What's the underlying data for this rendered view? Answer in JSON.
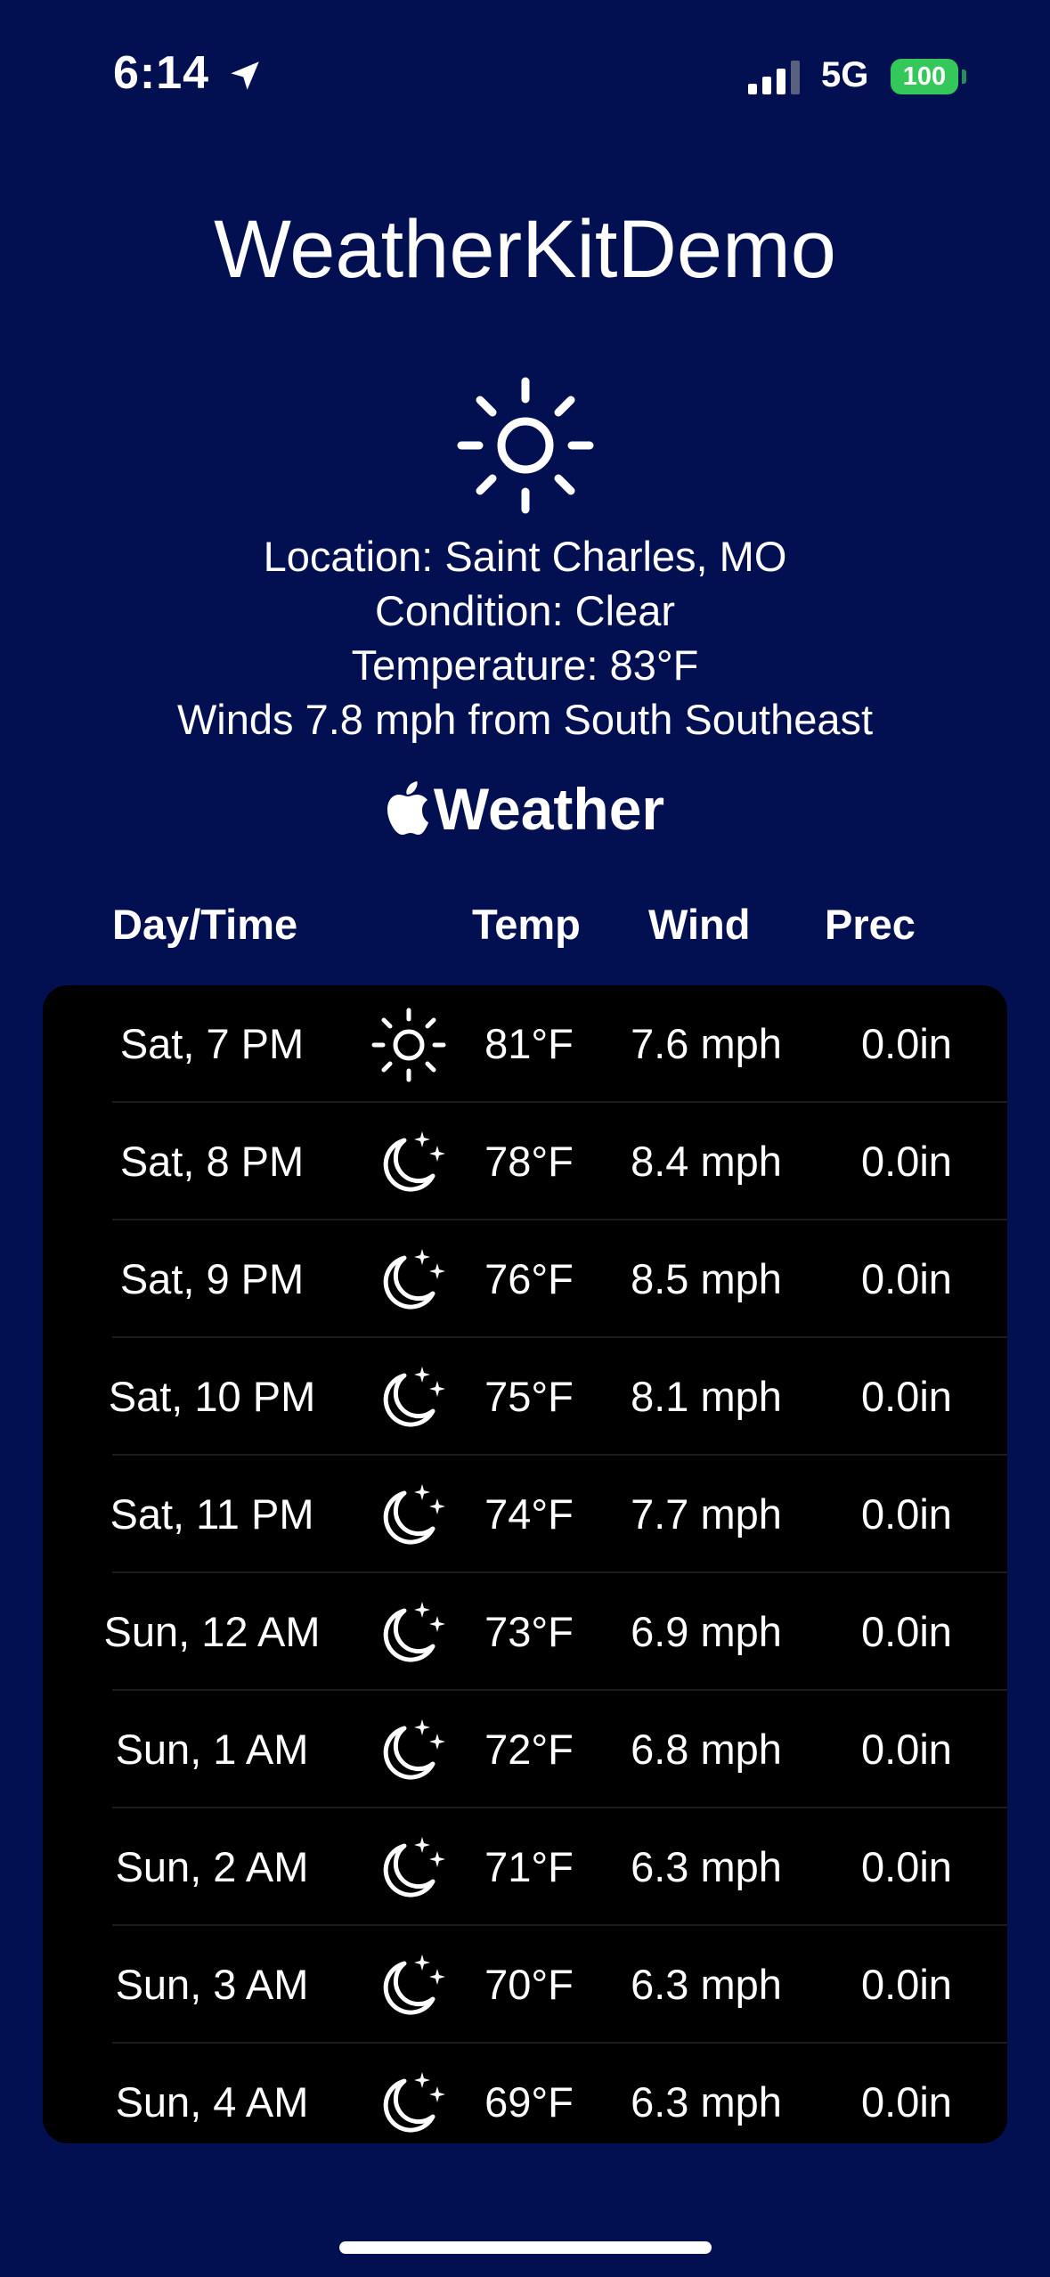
{
  "status_bar": {
    "time": "6:14",
    "network": "5G",
    "battery": "100"
  },
  "app": {
    "title": "WeatherKitDemo"
  },
  "current": {
    "icon": "sun-icon",
    "location": "Location: Saint Charles, MO",
    "condition": "Condition: Clear",
    "temperature": "Temperature: 83°F",
    "winds": "Winds 7.8 mph from South Southeast"
  },
  "attribution": {
    "label": "Weather"
  },
  "table": {
    "headers": {
      "day": "Day/Time",
      "temp": "Temp",
      "wind": "Wind",
      "prec": "Prec"
    },
    "rows": [
      {
        "day": "Sat, 7 PM",
        "icon": "sun-icon",
        "temp": "81°F",
        "wind": "7.6 mph",
        "prec": "0.0in"
      },
      {
        "day": "Sat, 8 PM",
        "icon": "moon-stars-icon",
        "temp": "78°F",
        "wind": "8.4 mph",
        "prec": "0.0in"
      },
      {
        "day": "Sat, 9 PM",
        "icon": "moon-stars-icon",
        "temp": "76°F",
        "wind": "8.5 mph",
        "prec": "0.0in"
      },
      {
        "day": "Sat, 10 PM",
        "icon": "moon-stars-icon",
        "temp": "75°F",
        "wind": "8.1 mph",
        "prec": "0.0in"
      },
      {
        "day": "Sat, 11 PM",
        "icon": "moon-stars-icon",
        "temp": "74°F",
        "wind": "7.7 mph",
        "prec": "0.0in"
      },
      {
        "day": "Sun, 12 AM",
        "icon": "moon-stars-icon",
        "temp": "73°F",
        "wind": "6.9 mph",
        "prec": "0.0in"
      },
      {
        "day": "Sun, 1 AM",
        "icon": "moon-stars-icon",
        "temp": "72°F",
        "wind": "6.8 mph",
        "prec": "0.0in"
      },
      {
        "day": "Sun, 2 AM",
        "icon": "moon-stars-icon",
        "temp": "71°F",
        "wind": "6.3 mph",
        "prec": "0.0in"
      },
      {
        "day": "Sun, 3 AM",
        "icon": "moon-stars-icon",
        "temp": "70°F",
        "wind": "6.3 mph",
        "prec": "0.0in"
      },
      {
        "day": "Sun, 4 AM",
        "icon": "moon-stars-icon",
        "temp": "69°F",
        "wind": "6.3 mph",
        "prec": "0.0in"
      }
    ]
  },
  "colors": {
    "background": "#021052",
    "table_background": "#000000",
    "battery": "#34c759",
    "text": "#ffffff"
  }
}
